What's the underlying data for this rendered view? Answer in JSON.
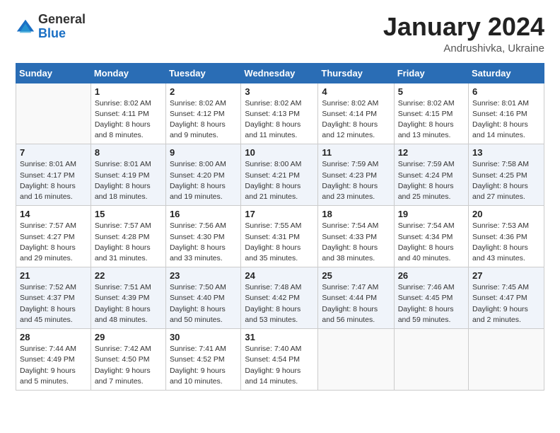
{
  "header": {
    "logo_general": "General",
    "logo_blue": "Blue",
    "month_title": "January 2024",
    "location": "Andrushivka, Ukraine"
  },
  "weekdays": [
    "Sunday",
    "Monday",
    "Tuesday",
    "Wednesday",
    "Thursday",
    "Friday",
    "Saturday"
  ],
  "weeks": [
    [
      {
        "day": "",
        "info": ""
      },
      {
        "day": "1",
        "info": "Sunrise: 8:02 AM\nSunset: 4:11 PM\nDaylight: 8 hours\nand 8 minutes."
      },
      {
        "day": "2",
        "info": "Sunrise: 8:02 AM\nSunset: 4:12 PM\nDaylight: 8 hours\nand 9 minutes."
      },
      {
        "day": "3",
        "info": "Sunrise: 8:02 AM\nSunset: 4:13 PM\nDaylight: 8 hours\nand 11 minutes."
      },
      {
        "day": "4",
        "info": "Sunrise: 8:02 AM\nSunset: 4:14 PM\nDaylight: 8 hours\nand 12 minutes."
      },
      {
        "day": "5",
        "info": "Sunrise: 8:02 AM\nSunset: 4:15 PM\nDaylight: 8 hours\nand 13 minutes."
      },
      {
        "day": "6",
        "info": "Sunrise: 8:01 AM\nSunset: 4:16 PM\nDaylight: 8 hours\nand 14 minutes."
      }
    ],
    [
      {
        "day": "7",
        "info": "Sunrise: 8:01 AM\nSunset: 4:17 PM\nDaylight: 8 hours\nand 16 minutes."
      },
      {
        "day": "8",
        "info": "Sunrise: 8:01 AM\nSunset: 4:19 PM\nDaylight: 8 hours\nand 18 minutes."
      },
      {
        "day": "9",
        "info": "Sunrise: 8:00 AM\nSunset: 4:20 PM\nDaylight: 8 hours\nand 19 minutes."
      },
      {
        "day": "10",
        "info": "Sunrise: 8:00 AM\nSunset: 4:21 PM\nDaylight: 8 hours\nand 21 minutes."
      },
      {
        "day": "11",
        "info": "Sunrise: 7:59 AM\nSunset: 4:23 PM\nDaylight: 8 hours\nand 23 minutes."
      },
      {
        "day": "12",
        "info": "Sunrise: 7:59 AM\nSunset: 4:24 PM\nDaylight: 8 hours\nand 25 minutes."
      },
      {
        "day": "13",
        "info": "Sunrise: 7:58 AM\nSunset: 4:25 PM\nDaylight: 8 hours\nand 27 minutes."
      }
    ],
    [
      {
        "day": "14",
        "info": "Sunrise: 7:57 AM\nSunset: 4:27 PM\nDaylight: 8 hours\nand 29 minutes."
      },
      {
        "day": "15",
        "info": "Sunrise: 7:57 AM\nSunset: 4:28 PM\nDaylight: 8 hours\nand 31 minutes."
      },
      {
        "day": "16",
        "info": "Sunrise: 7:56 AM\nSunset: 4:30 PM\nDaylight: 8 hours\nand 33 minutes."
      },
      {
        "day": "17",
        "info": "Sunrise: 7:55 AM\nSunset: 4:31 PM\nDaylight: 8 hours\nand 35 minutes."
      },
      {
        "day": "18",
        "info": "Sunrise: 7:54 AM\nSunset: 4:33 PM\nDaylight: 8 hours\nand 38 minutes."
      },
      {
        "day": "19",
        "info": "Sunrise: 7:54 AM\nSunset: 4:34 PM\nDaylight: 8 hours\nand 40 minutes."
      },
      {
        "day": "20",
        "info": "Sunrise: 7:53 AM\nSunset: 4:36 PM\nDaylight: 8 hours\nand 43 minutes."
      }
    ],
    [
      {
        "day": "21",
        "info": "Sunrise: 7:52 AM\nSunset: 4:37 PM\nDaylight: 8 hours\nand 45 minutes."
      },
      {
        "day": "22",
        "info": "Sunrise: 7:51 AM\nSunset: 4:39 PM\nDaylight: 8 hours\nand 48 minutes."
      },
      {
        "day": "23",
        "info": "Sunrise: 7:50 AM\nSunset: 4:40 PM\nDaylight: 8 hours\nand 50 minutes."
      },
      {
        "day": "24",
        "info": "Sunrise: 7:48 AM\nSunset: 4:42 PM\nDaylight: 8 hours\nand 53 minutes."
      },
      {
        "day": "25",
        "info": "Sunrise: 7:47 AM\nSunset: 4:44 PM\nDaylight: 8 hours\nand 56 minutes."
      },
      {
        "day": "26",
        "info": "Sunrise: 7:46 AM\nSunset: 4:45 PM\nDaylight: 8 hours\nand 59 minutes."
      },
      {
        "day": "27",
        "info": "Sunrise: 7:45 AM\nSunset: 4:47 PM\nDaylight: 9 hours\nand 2 minutes."
      }
    ],
    [
      {
        "day": "28",
        "info": "Sunrise: 7:44 AM\nSunset: 4:49 PM\nDaylight: 9 hours\nand 5 minutes."
      },
      {
        "day": "29",
        "info": "Sunrise: 7:42 AM\nSunset: 4:50 PM\nDaylight: 9 hours\nand 7 minutes."
      },
      {
        "day": "30",
        "info": "Sunrise: 7:41 AM\nSunset: 4:52 PM\nDaylight: 9 hours\nand 10 minutes."
      },
      {
        "day": "31",
        "info": "Sunrise: 7:40 AM\nSunset: 4:54 PM\nDaylight: 9 hours\nand 14 minutes."
      },
      {
        "day": "",
        "info": ""
      },
      {
        "day": "",
        "info": ""
      },
      {
        "day": "",
        "info": ""
      }
    ]
  ]
}
